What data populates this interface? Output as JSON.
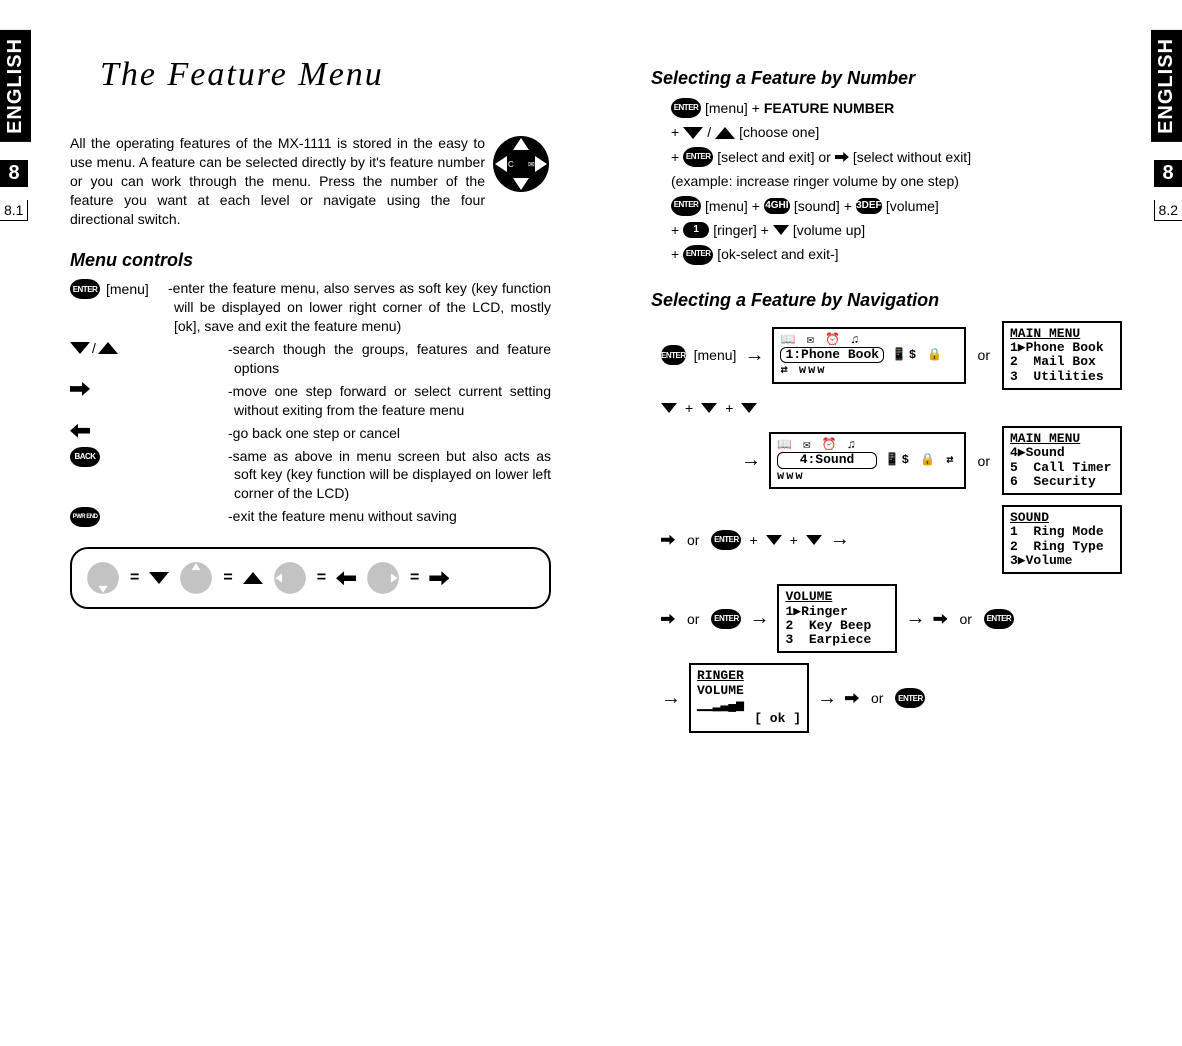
{
  "lang_label": "ENGLISH",
  "section_number": "8",
  "page_left": "8.1",
  "page_right": "8.2",
  "title": "The Feature Menu",
  "intro": "All the operating features of the MX-1111 is stored in the easy to use menu. A feature can be selected directly by it's feature number or you can work through the menu. Press the number of the feature you want at each level or navigate using the four directional switch.",
  "menu_controls_heading": "Menu controls",
  "controls": [
    {
      "icon": "enter",
      "label": "[menu]",
      "desc": "-enter the feature menu, also serves as soft key (key function will be displayed on lower right corner of the LCD, mostly [ok], save and exit the feature menu)"
    },
    {
      "icon": "down-up",
      "label": "",
      "desc": "-search though the groups, features and feature options"
    },
    {
      "icon": "right",
      "label": "",
      "desc": "-move one step forward or select current setting without exiting from the feature menu"
    },
    {
      "icon": "left",
      "label": "",
      "desc": "-go back one step or cancel"
    },
    {
      "icon": "back",
      "label": "",
      "desc": "-same as above in menu screen but also acts as soft key (key function will be displayed on lower left corner of the LCD)"
    },
    {
      "icon": "pwr",
      "label": "",
      "desc": "-exit the feature menu without saving"
    }
  ],
  "legend_eq": "=",
  "select_by_number_heading": "Selecting a Feature by Number",
  "proc_number": {
    "line1_menu": "[menu] +",
    "line1_bold": "FEATURE NUMBER",
    "line2": "[choose one]",
    "line3_a": "[select and exit] or",
    "line3_b": "[select without exit]",
    "example": "(example: increase ringer volume by one step)",
    "ex_line1": "[menu] +",
    "ex_line1b": "[sound] +",
    "ex_line1c": "[volume]",
    "ex_line2a": "[ringer] +",
    "ex_line2b": "[volume up]",
    "ex_line3": "[ok-select and exit-]"
  },
  "select_by_nav_heading": "Selecting a Feature by Navigation",
  "nav_menu_label": "[menu]",
  "or_label": "or",
  "plus_label": "+",
  "lcd_screens": {
    "phonebook_box": "1:Phone Book",
    "mainmenu_title": "MAIN MENU",
    "mainmenu_1": "1▶Phone Book",
    "mainmenu_2": "2  Mail Box",
    "mainmenu_3": "3  Utilities",
    "sound_box": "4:Sound",
    "mainmenu2_4": "4▶Sound",
    "mainmenu2_5": "5  Call Timer",
    "mainmenu2_6": "6  Security",
    "sound_title": "SOUND",
    "sound_1": "1  Ring Mode",
    "sound_2": "2  Ring Type",
    "sound_3": "3▶Volume",
    "volume_title": "VOLUME",
    "volume_1": "1▶Ringer",
    "volume_2": "2  Key Beep",
    "volume_3": "3  Earpiece",
    "ringer_title": "RINGER",
    "ringer_sub": "VOLUME",
    "ringer_bars": "▁▁▂▃▄▅",
    "ringer_ok": "[ ok ]"
  },
  "key_labels": {
    "enter": "ENTER",
    "back": "BACK",
    "pwr": "PWR END",
    "k1": "1",
    "k3": "3DEF",
    "k4": "4GHI"
  }
}
